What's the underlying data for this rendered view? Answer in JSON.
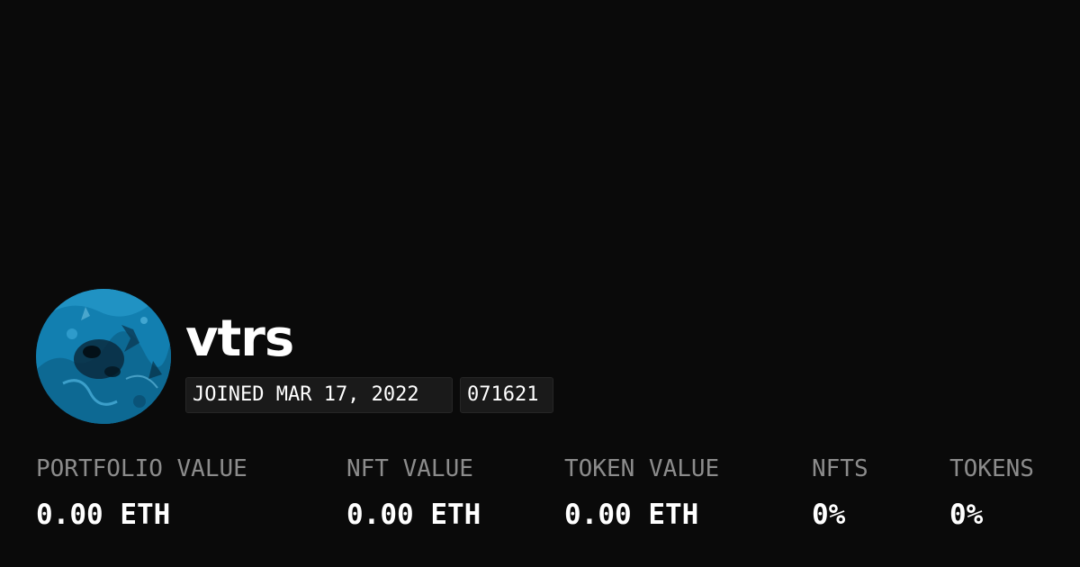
{
  "profile": {
    "username": "vtrs",
    "joined": "JOINED MAR 17, 2022",
    "id": "071621",
    "avatar_color": "#1486b8"
  },
  "stats": [
    {
      "label": "PORTFOLIO VALUE",
      "value": "0.00 ETH"
    },
    {
      "label": "NFT VALUE",
      "value": "0.00 ETH"
    },
    {
      "label": "TOKEN VALUE",
      "value": "0.00 ETH"
    },
    {
      "label": "NFTS",
      "value": "0%"
    },
    {
      "label": "TOKENS",
      "value": "0%"
    }
  ],
  "colors": {
    "background": "#0a0a0a",
    "text": "#ffffff",
    "muted": "#8c8c8c",
    "badge": "#1a1a1a"
  }
}
